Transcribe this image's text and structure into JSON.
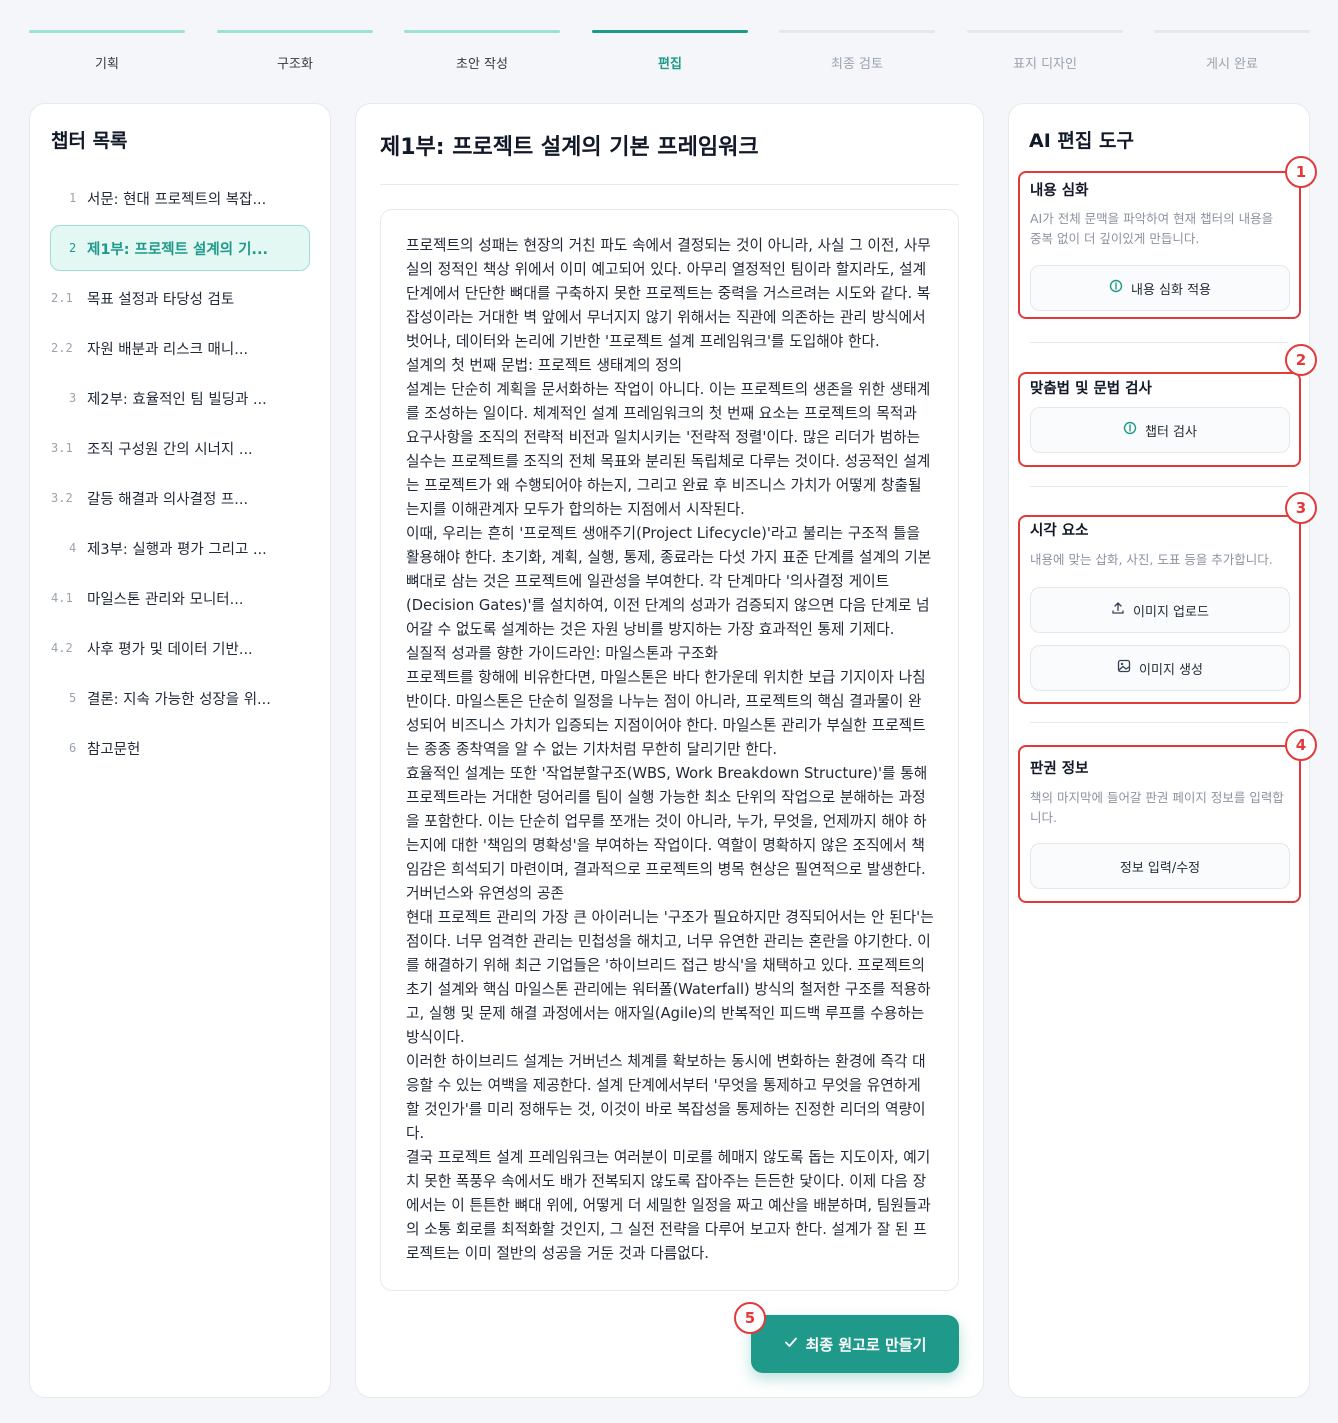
{
  "stepper": [
    {
      "label": "기획",
      "state": "done"
    },
    {
      "label": "구조화",
      "state": "done"
    },
    {
      "label": "초안 작성",
      "state": "done"
    },
    {
      "label": "편집",
      "state": "active"
    },
    {
      "label": "최종 검토",
      "state": "todo"
    },
    {
      "label": "표지 디자인",
      "state": "todo"
    },
    {
      "label": "게시 완료",
      "state": "todo"
    }
  ],
  "sidebar": {
    "title": "챕터 목록",
    "items": [
      {
        "num": "1",
        "label": "서문: 현대 프로젝트의 복잡...",
        "sub": false,
        "active": false
      },
      {
        "num": "2",
        "label": "제1부: 프로젝트 설계의 기...",
        "sub": false,
        "active": true
      },
      {
        "num": "2.1",
        "label": "목표 설정과 타당성 검토",
        "sub": true,
        "active": false
      },
      {
        "num": "2.2",
        "label": "자원 배분과 리스크 매니...",
        "sub": true,
        "active": false
      },
      {
        "num": "3",
        "label": "제2부: 효율적인 팀 빌딩과 ...",
        "sub": false,
        "active": false
      },
      {
        "num": "3.1",
        "label": "조직 구성원 간의 시너지 ...",
        "sub": true,
        "active": false
      },
      {
        "num": "3.2",
        "label": "갈등 해결과 의사결정 프...",
        "sub": true,
        "active": false
      },
      {
        "num": "4",
        "label": "제3부: 실행과 평가 그리고 ...",
        "sub": false,
        "active": false
      },
      {
        "num": "4.1",
        "label": "마일스톤 관리와 모니터...",
        "sub": true,
        "active": false
      },
      {
        "num": "4.2",
        "label": "사후 평가 및 데이터 기반...",
        "sub": true,
        "active": false
      },
      {
        "num": "5",
        "label": "결론: 지속 가능한 성장을 위...",
        "sub": false,
        "active": false
      },
      {
        "num": "6",
        "label": "참고문헌",
        "sub": false,
        "active": false
      }
    ]
  },
  "editor": {
    "chapter_title": "제1부: 프로젝트 설계의 기본 프레임워크",
    "paragraphs": [
      "프로젝트의 성패는 현장의 거친 파도 속에서 결정되는 것이 아니라, 사실 그 이전, 사무실의 정적인 책상 위에서 이미 예고되어 있다. 아무리 열정적인 팀이라 할지라도, 설계 단계에서 단단한 뼈대를 구축하지 못한 프로젝트는 중력을 거스르려는 시도와 같다. 복잡성이라는 거대한 벽 앞에서 무너지지 않기 위해서는 직관에 의존하는 관리 방식에서 벗어나, 데이터와 논리에 기반한 '프로젝트 설계 프레임워크'를 도입해야 한다.",
      "설계의 첫 번째 문법: 프로젝트 생태계의 정의",
      "설계는 단순히 계획을 문서화하는 작업이 아니다. 이는 프로젝트의 생존을 위한 생태계를 조성하는 일이다. 체계적인 설계 프레임워크의 첫 번째 요소는 프로젝트의 목적과 요구사항을 조직의 전략적 비전과 일치시키는 '전략적 정렬'이다. 많은 리더가 범하는 실수는 프로젝트를 조직의 전체 목표와 분리된 독립체로 다루는 것이다. 성공적인 설계는 프로젝트가 왜 수행되어야 하는지, 그리고 완료 후 비즈니스 가치가 어떻게 창출될는지를 이해관계자 모두가 합의하는 지점에서 시작된다.",
      "이때, 우리는 흔히 '프로젝트 생애주기(Project Lifecycle)'라고 불리는 구조적 틀을 활용해야 한다. 초기화, 계획, 실행, 통제, 종료라는 다섯 가지 표준 단계를 설계의 기본 뼈대로 삼는 것은 프로젝트에 일관성을 부여한다. 각 단계마다 '의사결정 게이트(Decision Gates)'를 설치하여, 이전 단계의 성과가 검증되지 않으면 다음 단계로 넘어갈 수 없도록 설계하는 것은 자원 낭비를 방지하는 가장 효과적인 통제 기제다.",
      "실질적 성과를 향한 가이드라인: 마일스톤과 구조화",
      "프로젝트를 항해에 비유한다면, 마일스톤은 바다 한가운데 위치한 보급 기지이자 나침반이다. 마일스톤은 단순히 일정을 나누는 점이 아니라, 프로젝트의 핵심 결과물이 완성되어 비즈니스 가치가 입증되는 지점이어야 한다. 마일스톤 관리가 부실한 프로젝트는 종종 종착역을 알 수 없는 기차처럼 무한히 달리기만 한다.",
      "효율적인 설계는 또한 '작업분할구조(WBS, Work Breakdown Structure)'를 통해 프로젝트라는 거대한 덩어리를 팀이 실행 가능한 최소 단위의 작업으로 분해하는 과정을 포함한다. 이는 단순히 업무를 쪼개는 것이 아니라, 누가, 무엇을, 언제까지 해야 하는지에 대한 '책임의 명확성'을 부여하는 작업이다. 역할이 명확하지 않은 조직에서 책임감은 희석되기 마련이며, 결과적으로 프로젝트의 병목 현상은 필연적으로 발생한다.",
      "거버넌스와 유연성의 공존",
      "현대 프로젝트 관리의 가장 큰 아이러니는 '구조가 필요하지만 경직되어서는 안 된다'는 점이다. 너무 엄격한 관리는 민첩성을 해치고, 너무 유연한 관리는 혼란을 야기한다. 이를 해결하기 위해 최근 기업들은 '하이브리드 접근 방식'을 채택하고 있다. 프로젝트의 초기 설계와 핵심 마일스톤 관리에는 워터폴(Waterfall) 방식의 철저한 구조를 적용하고, 실행 및 문제 해결 과정에서는 애자일(Agile)의 반복적인 피드백 루프를 수용하는 방식이다.",
      "이러한 하이브리드 설계는 거버넌스 체계를 확보하는 동시에 변화하는 환경에 즉각 대응할 수 있는 여백을 제공한다. 설계 단계에서부터 '무엇을 통제하고 무엇을 유연하게 할 것인가'를 미리 정해두는 것, 이것이 바로 복잡성을 통제하는 진정한 리더의 역량이다.",
      "결국 프로젝트 설계 프레임워크는 여러분이 미로를 헤매지 않도록 돕는 지도이자, 예기치 못한 폭풍우 속에서도 배가 전복되지 않도록 잡아주는 든든한 닻이다. 이제 다음 장에서는 이 튼튼한 뼈대 위에, 어떻게 더 세밀한 일정을 짜고 예산을 배분하며, 팀원들과의 소통 회로를 최적화할 것인지, 그 실전 전략을 다루어 보고자 한다. 설계가 잘 된 프로젝트는 이미 절반의 성공을 거둔 것과 다름없다."
    ],
    "final_button": "최종 원고로 만들기"
  },
  "tools": {
    "title": "AI 편집 도구",
    "deepen": {
      "title": "내용 심화",
      "desc": "AI가 전체 문맥을 파악하여 현재 챕터의 내용을 중복 없이 더 깊이있게 만듭니다.",
      "button": "내용 심화 적용"
    },
    "spell": {
      "title": "맞춤법 및 문법 검사",
      "button": "챕터 검사"
    },
    "visual": {
      "title": "시각 요소",
      "desc": "내용에 맞는 삽화, 사진, 도표 등을 추가합니다.",
      "upload_button": "이미지 업로드",
      "generate_button": "이미지 생성"
    },
    "copyright": {
      "title": "판권 정보",
      "desc": "책의 마지막에 들어갈 판권 페이지 정보를 입력합니다.",
      "button": "정보 입력/수정"
    }
  },
  "badges": [
    "1",
    "2",
    "3",
    "4",
    "5"
  ],
  "colors": {
    "accent": "#1f9a8a",
    "highlight": "#e23a3a",
    "accent_light": "#e3f7f3"
  },
  "icons": {
    "deepen": "ai-sparkle-icon",
    "spell": "ai-sparkle-icon",
    "upload": "upload-icon",
    "generate": "image-icon",
    "final": "check-icon"
  }
}
